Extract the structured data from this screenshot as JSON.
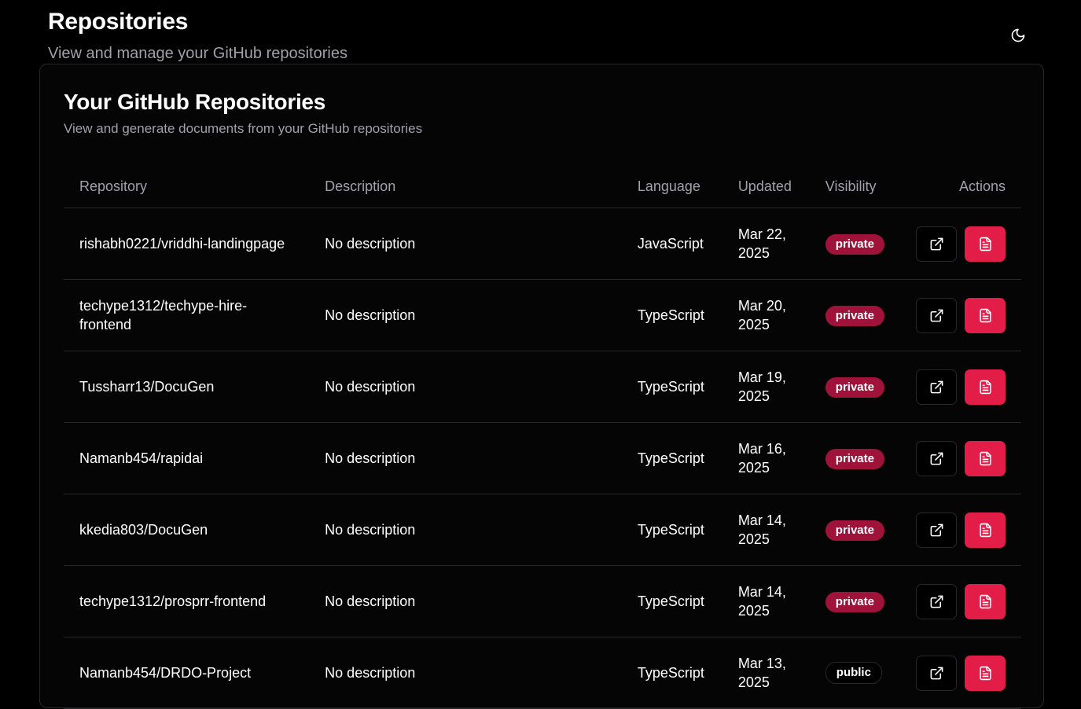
{
  "header": {
    "title": "Repositories",
    "subtitle": "View and manage your GitHub repositories"
  },
  "theme_toggle": {
    "icon": "moon-icon"
  },
  "card": {
    "title": "Your GitHub Repositories",
    "subtitle": "View and generate documents from your GitHub repositories"
  },
  "table": {
    "columns": [
      "Repository",
      "Description",
      "Language",
      "Updated",
      "Visibility",
      "Actions"
    ],
    "rows": [
      {
        "repo": "rishabh0221/vriddhi-landingpage",
        "description": "No description",
        "language": "JavaScript",
        "updated_line1": "Mar 22,",
        "updated_line2": "2025",
        "visibility": "private"
      },
      {
        "repo": "techype1312/techype-hire-frontend",
        "description": "No description",
        "language": "TypeScript",
        "updated_line1": "Mar 20,",
        "updated_line2": "2025",
        "visibility": "private"
      },
      {
        "repo": "Tussharr13/DocuGen",
        "description": "No description",
        "language": "TypeScript",
        "updated_line1": "Mar 19,",
        "updated_line2": "2025",
        "visibility": "private"
      },
      {
        "repo": "Namanb454/rapidai",
        "description": "No description",
        "language": "TypeScript",
        "updated_line1": "Mar 16,",
        "updated_line2": "2025",
        "visibility": "private"
      },
      {
        "repo": "kkedia803/DocuGen",
        "description": "No description",
        "language": "TypeScript",
        "updated_line1": "Mar 14,",
        "updated_line2": "2025",
        "visibility": "private"
      },
      {
        "repo": "techype1312/prosprr-frontend",
        "description": "No description",
        "language": "TypeScript",
        "updated_line1": "Mar 14,",
        "updated_line2": "2025",
        "visibility": "private"
      },
      {
        "repo": "Namanb454/DRDO-Project",
        "description": "No description",
        "language": "TypeScript",
        "updated_line1": "Mar 13,",
        "updated_line2": "2025",
        "visibility": "public"
      }
    ]
  },
  "icons": {
    "open": "external-link-icon",
    "generate": "file-text-icon"
  },
  "colors": {
    "background": "#000000",
    "private_badge": "#9f1239",
    "doc_button": "#e11d48"
  }
}
